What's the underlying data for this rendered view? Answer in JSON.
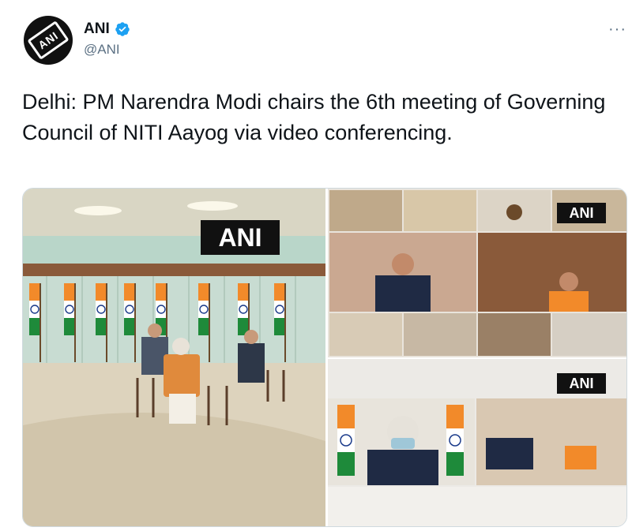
{
  "tweet": {
    "author_name": "ANI",
    "author_handle": "@ANI",
    "more_label": "···",
    "text": "Delhi: PM Narendra Modi chairs the 6th meeting of Governing Council of NITI Aayog via video conferencing.",
    "avatar_logo_text": "ANI"
  },
  "media": {
    "watermark_left": "ANI",
    "watermark_top_right": "ANI",
    "watermark_bottom_right": "ANI"
  },
  "colors": {
    "verified": "#1da1f2",
    "handle": "#5b7083",
    "saffron": "#f28a2a",
    "green": "#1e8a3a"
  },
  "icons": {
    "verified": "verified-badge-icon",
    "more": "more-options-icon"
  }
}
